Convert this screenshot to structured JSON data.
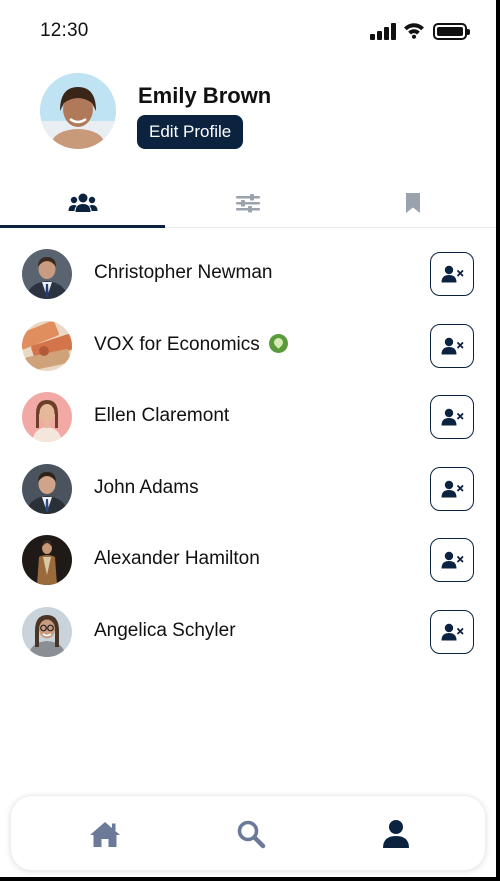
{
  "status_bar": {
    "time": "12:30"
  },
  "profile": {
    "name": "Emily Brown",
    "edit_label": "Edit Profile"
  },
  "tabs": [
    {
      "icon": "users-icon",
      "active": true
    },
    {
      "icon": "sliders-icon",
      "active": false
    },
    {
      "icon": "bookmark-icon",
      "active": false
    }
  ],
  "list": [
    {
      "name": "Christopher Newman",
      "verified": false
    },
    {
      "name": "VOX for Economics",
      "verified": true
    },
    {
      "name": "Ellen Claremont",
      "verified": false
    },
    {
      "name": "John Adams",
      "verified": false
    },
    {
      "name": "Alexander Hamilton",
      "verified": false
    },
    {
      "name": "Angelica Schyler",
      "verified": false
    }
  ],
  "bottom_nav": [
    {
      "icon": "home-icon",
      "active": false
    },
    {
      "icon": "search-icon",
      "active": false
    },
    {
      "icon": "user-icon",
      "active": true
    }
  ],
  "colors": {
    "accent": "#0c2340",
    "inactive_icon": "#6b7a99",
    "muted_icon": "#9aa3ad",
    "verified": "#5a9a3a"
  }
}
